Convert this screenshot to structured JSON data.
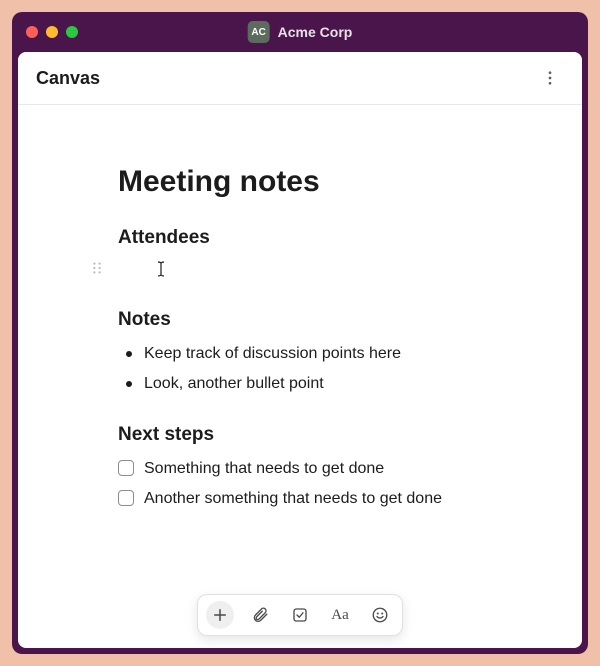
{
  "workspace": {
    "badge": "AC",
    "name": "Acme Corp"
  },
  "canvas": {
    "title": "Canvas"
  },
  "doc": {
    "title": "Meeting notes",
    "attendees_heading": "Attendees",
    "notes_heading": "Notes",
    "notes": [
      "Keep track of discussion points here",
      "Look, another bullet point"
    ],
    "next_steps_heading": "Next steps",
    "next_steps": [
      "Something that needs to get done",
      "Another something that needs to get done"
    ]
  },
  "toolbar": {
    "aa_label": "Aa"
  }
}
